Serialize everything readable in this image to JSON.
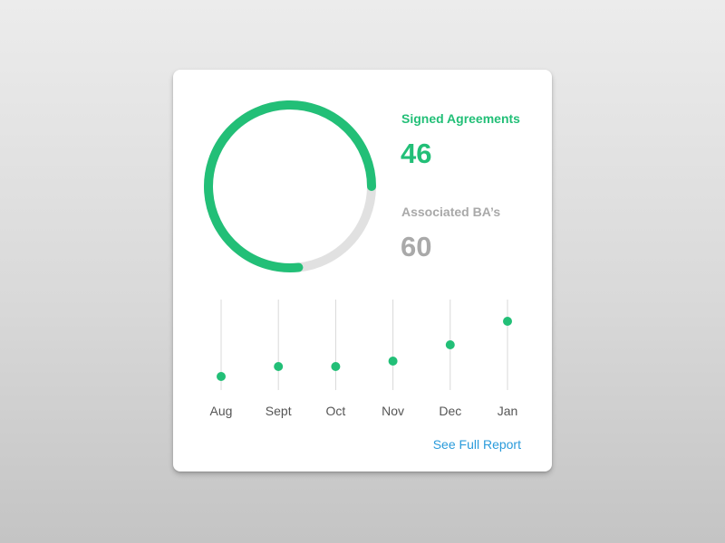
{
  "colors": {
    "accent": "#22bf77",
    "secondary_text": "#a9a9a9",
    "track": "#e1e1e1",
    "stem": "#d8d8d8",
    "link": "#2a9bdb",
    "month_text": "#555555"
  },
  "stats": {
    "signed_label": "Signed Agreements",
    "signed_value": "46",
    "ba_label": "Associated BA’s",
    "ba_value": "60"
  },
  "link": {
    "label": "See Full Report"
  },
  "chart_data": [
    {
      "type": "pie",
      "values": [
        46,
        60
      ]
    },
    {
      "type": "scatter",
      "categories": [
        "Aug",
        "Sept",
        "Oct",
        "Nov",
        "Dec",
        "Jan"
      ],
      "values": [
        1.5,
        2.6,
        2.6,
        3.2,
        5.0,
        7.6
      ],
      "ylim": [
        0,
        10
      ],
      "grid": true
    }
  ]
}
